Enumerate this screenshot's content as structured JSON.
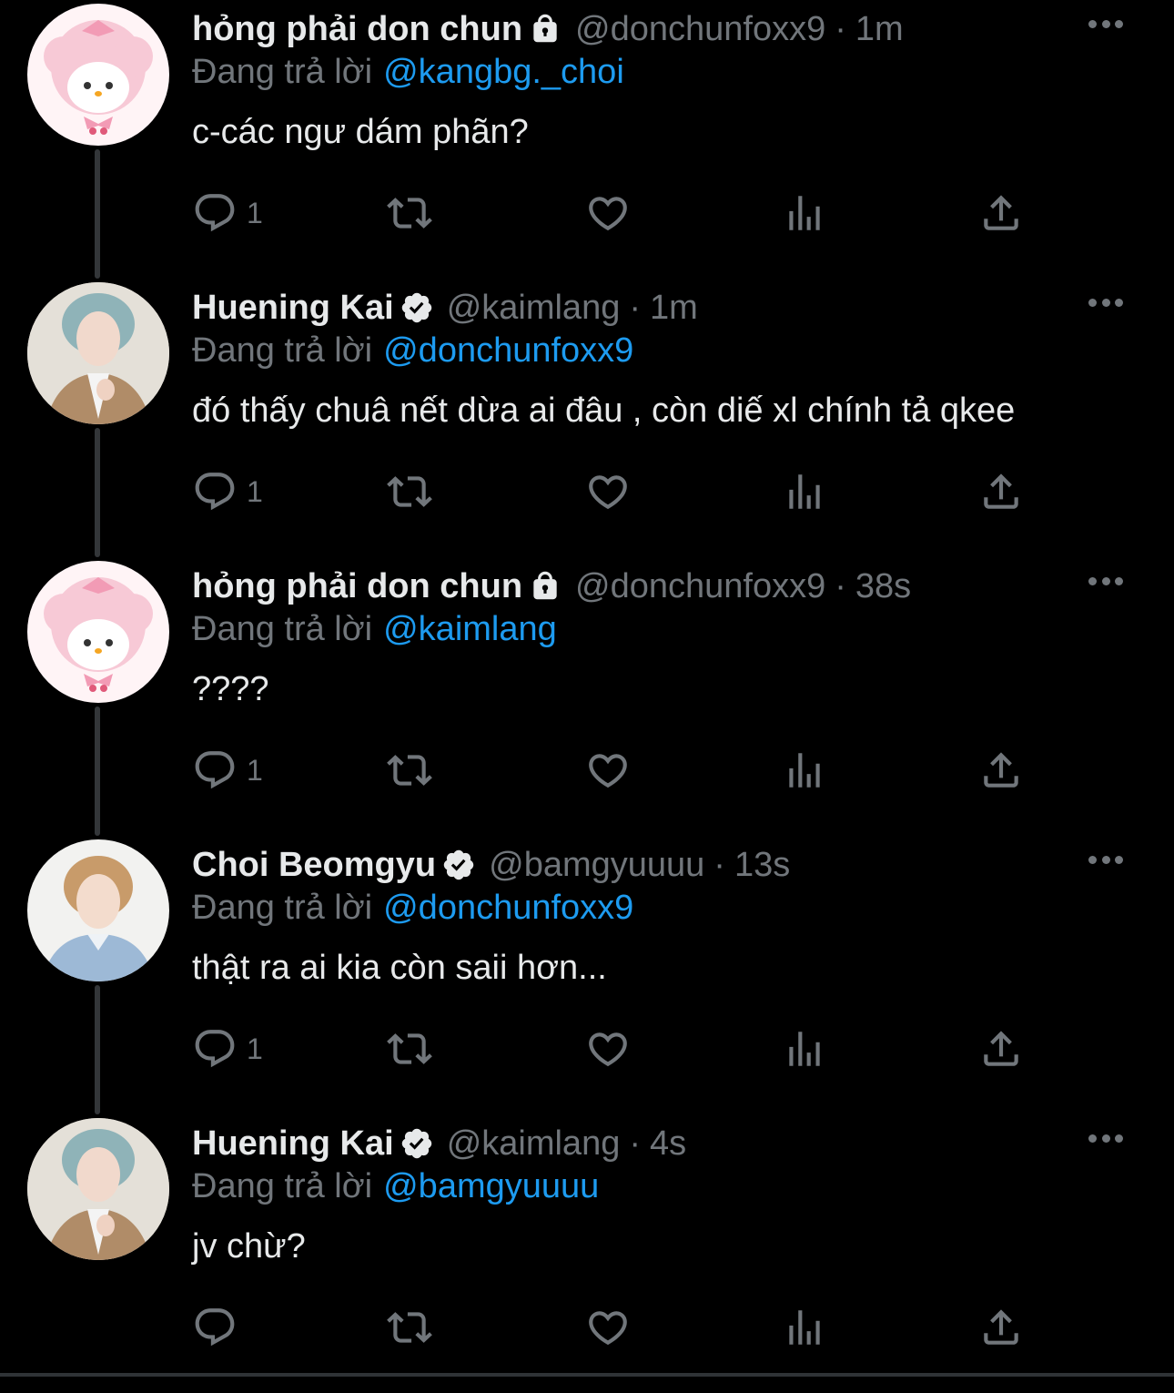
{
  "colors": {
    "background": "#000000",
    "text": "#e7e9ea",
    "muted": "#71767b",
    "link": "#1d9bf0"
  },
  "reply_prefix": "Đang trả lời",
  "tweets": [
    {
      "name": "hỏng phải don chun",
      "badge": "lock-icon",
      "handle": "@donchunfoxx9",
      "time": "1m",
      "reply_to": "@kangbg._choi",
      "text": "c-các ngư dám phãn?",
      "reply_count": "1"
    },
    {
      "name": "Huening Kai",
      "badge": "verified-badge-icon",
      "handle": "@kaimlang",
      "time": "1m",
      "reply_to": "@donchunfoxx9",
      "text": "đó thấy chuâ nết dừa ai đâu , còn diế xl chính tả qkee",
      "reply_count": "1"
    },
    {
      "name": "hỏng phải don chun",
      "badge": "lock-icon",
      "handle": "@donchunfoxx9",
      "time": "38s",
      "reply_to": "@kaimlang",
      "text": "????",
      "reply_count": "1"
    },
    {
      "name": "Choi Beomgyu",
      "badge": "verified-badge-icon",
      "handle": "@bamgyuuuu",
      "time": "13s",
      "reply_to": "@donchunfoxx9",
      "text": "thật ra ai kia còn saii hơn...",
      "reply_count": "1"
    },
    {
      "name": "Huening Kai",
      "badge": "verified-badge-icon",
      "handle": "@kaimlang",
      "time": "4s",
      "reply_to": "@bamgyuuuu",
      "text": "jv chừ?",
      "reply_count": ""
    }
  ],
  "sep": "·"
}
